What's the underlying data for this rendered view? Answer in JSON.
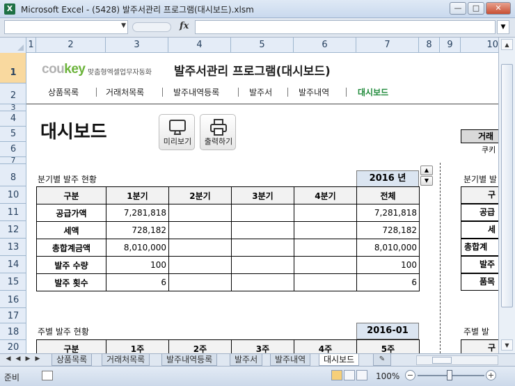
{
  "window": {
    "title": "Microsoft Excel - (5428) 발주서관리 프로그램(대시보드).xlsm"
  },
  "formula_bar": {
    "name_box": "",
    "fx_label": "fx",
    "formula": ""
  },
  "columns": [
    "1",
    "2",
    "3",
    "4",
    "5",
    "6",
    "7",
    "8",
    "9",
    "10"
  ],
  "rows": [
    "1",
    "2",
    "3",
    "4",
    "5",
    "6",
    "7",
    "8",
    "10",
    "11",
    "12",
    "13",
    "14",
    "15",
    "16",
    "17",
    "18",
    "20"
  ],
  "header": {
    "logo_cou": "cou",
    "logo_key": "key",
    "tagline": "맞춤형엑셀업무자동화",
    "app_title": "발주서관리 프로그램(대시보드)"
  },
  "menu": [
    "상품목록",
    "거래처목록",
    "발주내역등록",
    "발주서",
    "발주내역",
    "대시보드"
  ],
  "page_title": "대시보드",
  "buttons": {
    "preview": "미리보기",
    "print": "출력하기"
  },
  "quarterly": {
    "label": "분기별 발주 현황",
    "year": "2016 년",
    "headers": [
      "구분",
      "1분기",
      "2분기",
      "3분기",
      "4분기",
      "전체"
    ],
    "rows": [
      [
        "공급가액",
        "7,281,818",
        "",
        "",
        "",
        "7,281,818"
      ],
      [
        "세액",
        "728,182",
        "",
        "",
        "",
        "728,182"
      ],
      [
        "총합계금액",
        "8,010,000",
        "",
        "",
        "",
        "8,010,000"
      ],
      [
        "발주 수량",
        "100",
        "",
        "",
        "",
        "100"
      ],
      [
        "발주 횟수",
        "6",
        "",
        "",
        "",
        "6"
      ]
    ]
  },
  "weekly": {
    "label": "주별 발주 현황",
    "month": "2016-01",
    "headers": [
      "구분",
      "1주",
      "2주",
      "3주",
      "4주",
      "5주"
    ]
  },
  "right_panel": {
    "vendor_header": "거래",
    "vendor_value": "쿠키",
    "quarter_label": "분기별 발",
    "row_labels": [
      "구",
      "공급",
      "세",
      "총합계",
      "발주",
      "품목"
    ],
    "weekly_label": "주별 발",
    "weekly_header": "구"
  },
  "sheet_tabs": [
    "상품목록",
    "거래처목록",
    "발주내역등록",
    "발주서",
    "발주내역",
    "대시보드"
  ],
  "active_tab": "대시보드",
  "status": {
    "ready": "준비",
    "zoom": "100%"
  }
}
